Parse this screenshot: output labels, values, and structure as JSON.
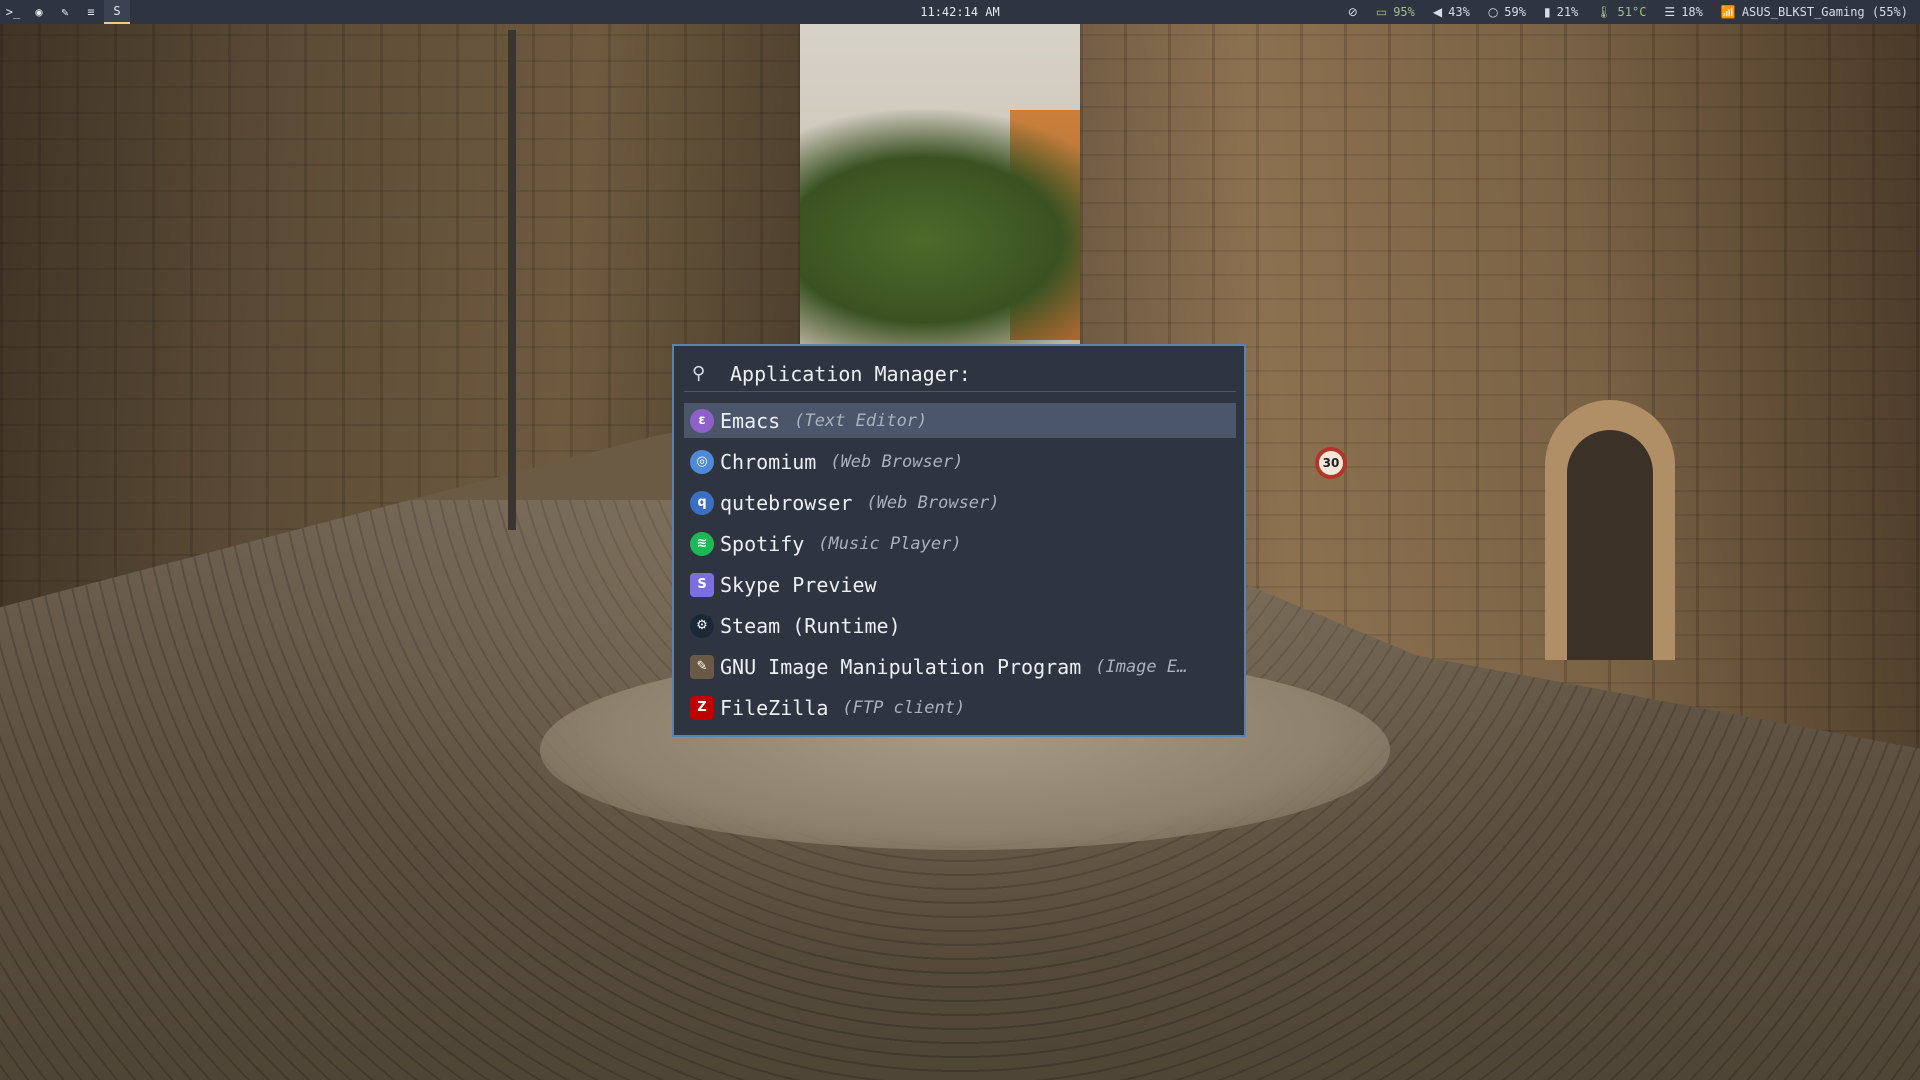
{
  "topbar": {
    "workspaces": [
      {
        "glyph": ">_",
        "icon": "terminal-icon",
        "active": false
      },
      {
        "glyph": "◉",
        "icon": "browser-icon",
        "active": false
      },
      {
        "glyph": "✎",
        "icon": "editor-icon",
        "active": false
      },
      {
        "glyph": "≡",
        "icon": "music-icon",
        "active": false
      },
      {
        "glyph": "S",
        "icon": "chat-icon",
        "active": true
      }
    ],
    "clock": "11:42:14 AM",
    "status": {
      "visibility": {
        "glyph": "⊘",
        "icon": "eye-off-icon"
      },
      "battery": {
        "glyph": "▭",
        "icon": "battery-icon",
        "value": "95%",
        "color": "#a3be8c"
      },
      "volume": {
        "glyph": "◀",
        "icon": "volume-icon",
        "value": "43%"
      },
      "cpu": {
        "glyph": "○",
        "icon": "cpu-icon",
        "value": "59%"
      },
      "memory": {
        "glyph": "▮",
        "icon": "memory-icon",
        "value": "21%"
      },
      "temperature": {
        "glyph": "🌡",
        "icon": "thermometer-icon",
        "value": "51°C",
        "color": "#a3be8c"
      },
      "disk": {
        "glyph": "☰",
        "icon": "disk-icon",
        "value": "18%"
      },
      "wifi": {
        "glyph": "📶",
        "icon": "wifi-icon",
        "value": "ASUS_BLKST_Gaming (55%)"
      }
    }
  },
  "launcher": {
    "header_icon": {
      "glyph": "⚲",
      "icon": "launcher-icon"
    },
    "prompt": "Application Manager:",
    "items": [
      {
        "name": "Emacs",
        "desc": "(Text Editor)",
        "icon": "emacs-icon",
        "glyph": "ε",
        "color": "#8e60c9",
        "selected": true
      },
      {
        "name": "Chromium",
        "desc": "(Web Browser)",
        "icon": "chromium-icon",
        "glyph": "◎",
        "color": "#4f8ad9",
        "selected": false
      },
      {
        "name": "qutebrowser",
        "desc": "(Web Browser)",
        "icon": "qutebrowser-icon",
        "glyph": "q",
        "color": "#3a6fc4",
        "selected": false
      },
      {
        "name": "Spotify",
        "desc": "(Music Player)",
        "icon": "spotify-icon",
        "glyph": "≋",
        "color": "#1db954",
        "selected": false
      },
      {
        "name": "Skype Preview",
        "desc": "",
        "icon": "skype-icon",
        "glyph": "S",
        "color": "#7b6fe0",
        "selected": false
      },
      {
        "name": "Steam (Runtime)",
        "desc": "",
        "icon": "steam-icon",
        "glyph": "⚙",
        "color": "#1b2838",
        "selected": false
      },
      {
        "name": "GNU Image Manipulation Program",
        "desc": "(Image E…",
        "icon": "gimp-icon",
        "glyph": "✎",
        "color": "#6a5a45",
        "selected": false
      },
      {
        "name": "FileZilla",
        "desc": "(FTP client)",
        "icon": "filezilla-icon",
        "glyph": "Z",
        "color": "#bf0000",
        "selected": false
      }
    ]
  },
  "wallpaper": {
    "sign": "30"
  }
}
